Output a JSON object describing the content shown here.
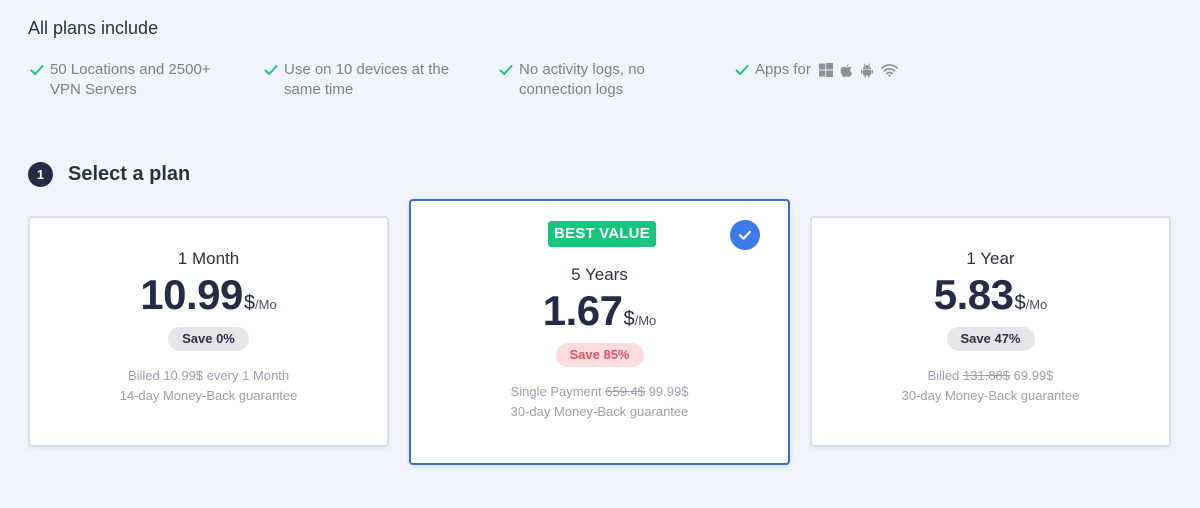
{
  "includes": {
    "title": "All plans include",
    "features": [
      {
        "text": "50 Locations and 2500+ VPN Servers",
        "icon": "check-icon"
      },
      {
        "text": "Use on 10 devices at the same time",
        "icon": "check-icon"
      },
      {
        "text": "No activity logs, no connection logs",
        "icon": "check-icon"
      },
      {
        "text": "Apps for",
        "icon": "check-icon"
      }
    ],
    "os_icons": [
      "windows-icon",
      "apple-icon",
      "android-icon",
      "wifi-icon"
    ]
  },
  "step": {
    "number": "1",
    "title": "Select a plan"
  },
  "plans": [
    {
      "name": "1 Month",
      "price": "10.99",
      "currency": "$",
      "per": "/Mo",
      "save": "Save 0%",
      "billing_line1_prefix": "Billed 10.99$ every 1 Month",
      "billing_line2": "14-day Money-Back guarantee",
      "selected": false
    },
    {
      "badge": "BEST VALUE",
      "name": "5 Years",
      "price": "1.67",
      "currency": "$",
      "per": "/Mo",
      "save": "Save 85%",
      "billing_line1_prefix": "Single Payment",
      "billing_line1_strike": "659.4$",
      "billing_line1_value": "99.99$",
      "billing_line2": "30-day Money-Back guarantee",
      "selected": true
    },
    {
      "name": "1 Year",
      "price": "5.83",
      "currency": "$",
      "per": "/Mo",
      "save": "Save 47%",
      "billing_line1_prefix": "Billed",
      "billing_line1_strike": "131.88$",
      "billing_line1_value": "69.99$",
      "billing_line2": "30-day Money-Back guarantee",
      "selected": false
    }
  ],
  "colors": {
    "background": "#f1f5fb",
    "check_green": "#19c47c",
    "best_value_green": "#19c47c",
    "selected_border": "#3d6fc6",
    "selected_check": "#3e7ae8",
    "save_hot_bg": "#fbdde0",
    "save_hot_text": "#e0535d",
    "price_text": "#242b44"
  }
}
